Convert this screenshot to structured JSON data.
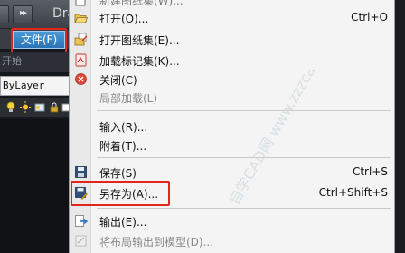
{
  "app": {
    "title": "Dra",
    "quick_access_glyph": "▸▸",
    "file_menu_label": "文件(F)",
    "start_label": "开始",
    "layer_combo_value": "ByLayer"
  },
  "menu": {
    "top_partial": {
      "label": "新建图纸集(W)...",
      "icon": "sheet-set-icon"
    },
    "items": [
      {
        "label": "打开(O)...",
        "shortcut": "Ctrl+O",
        "icon": "open-folder-icon",
        "enabled": true
      },
      {
        "label": "打开图纸集(E)...",
        "shortcut": "",
        "icon": "open-sheet-set-icon",
        "enabled": true
      },
      {
        "label": "加载标记集(K)...",
        "shortcut": "",
        "icon": "load-markup-icon",
        "enabled": true
      },
      {
        "label": "关闭(C)",
        "shortcut": "",
        "icon": "close-icon",
        "enabled": true
      },
      {
        "label": "局部加载(L)",
        "shortcut": "",
        "icon": "",
        "enabled": false
      },
      {
        "label": "输入(R)...",
        "shortcut": "",
        "icon": "",
        "enabled": true
      },
      {
        "label": "附着(T)...",
        "shortcut": "",
        "icon": "",
        "enabled": true
      },
      {
        "label": "保存(S)",
        "shortcut": "Ctrl+S",
        "icon": "save-icon",
        "enabled": true
      },
      {
        "label": "另存为(A)...",
        "shortcut": "Ctrl+Shift+S",
        "icon": "save-as-icon",
        "enabled": true
      },
      {
        "label": "输出(E)...",
        "shortcut": "",
        "icon": "export-icon",
        "enabled": true
      },
      {
        "label": "将布局输出到模型(D)...",
        "shortcut": "",
        "icon": "",
        "enabled": false
      }
    ]
  },
  "watermark": {
    "text": "自学CAD网 www.zzzcad.com"
  },
  "colors": {
    "highlight_red": "#e3261c",
    "menu_bg": "#f4f4f4",
    "file_menu_blue": "#2b73b4"
  }
}
